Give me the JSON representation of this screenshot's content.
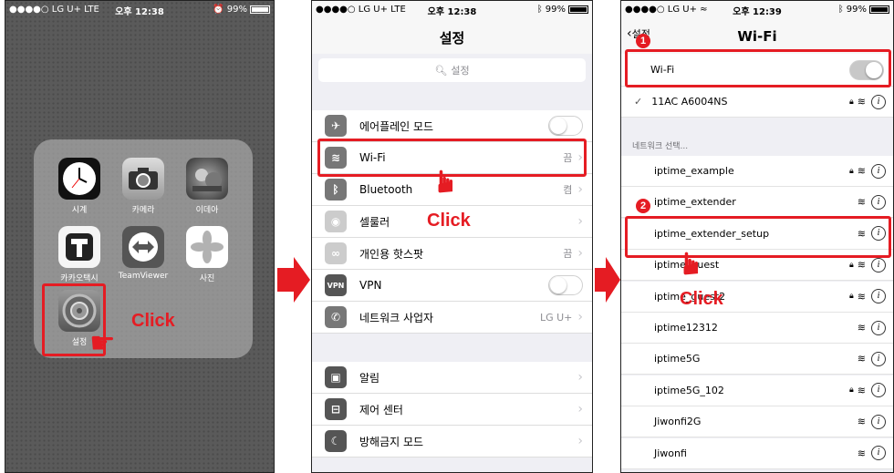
{
  "panel1": {
    "status": {
      "carrier": "●●●●○ LG U+ LTE",
      "time": "오후 12:38",
      "battery": "99%"
    },
    "apps": [
      {
        "name": "clock-app",
        "label": "시계"
      },
      {
        "name": "camera-app",
        "label": "카메라"
      },
      {
        "name": "game-app",
        "label": "이데아"
      },
      {
        "name": "kakaotaxi-app",
        "label": "카카오택시"
      },
      {
        "name": "teamviewer-app",
        "label": "TeamViewer"
      },
      {
        "name": "photos-app",
        "label": "사진"
      },
      {
        "name": "settings-app",
        "label": "설정"
      }
    ],
    "click_label": "Click"
  },
  "panel2": {
    "status": {
      "carrier": "●●●●○ LG U+ LTE",
      "time": "오후 12:38",
      "battery": "99%"
    },
    "title": "설정",
    "search_placeholder": "설정",
    "rows": [
      {
        "label": "에어플레인 모드",
        "value": "",
        "color": "#f29c2b",
        "glyph": "✈"
      },
      {
        "label": "Wi-Fi",
        "value": "끔",
        "color": "#8e8e93",
        "glyph": "≋"
      },
      {
        "label": "Bluetooth",
        "value": "켬",
        "color": "#8e8e93",
        "glyph": "ʙ"
      },
      {
        "label": "셀룰러",
        "value": "",
        "color": "#c7c7cc",
        "glyph": "◉"
      },
      {
        "label": "개인용 핫스팟",
        "value": "끔",
        "color": "#c7c7cc",
        "glyph": "∞"
      },
      {
        "label": "VPN",
        "value": "",
        "color": "#6d6d72",
        "glyph": "VPN"
      },
      {
        "label": "네트워크 사업자",
        "value": "LG U+",
        "color": "#8e8e93",
        "glyph": "✆"
      },
      {
        "label": "알림",
        "value": "",
        "color": "#6d6d72",
        "glyph": "▣"
      },
      {
        "label": "제어 센터",
        "value": "",
        "color": "#6d6d72",
        "glyph": "⊟"
      },
      {
        "label": "방해금지 모드",
        "value": "",
        "color": "#6d6d72",
        "glyph": "☾"
      }
    ],
    "click_label": "Click"
  },
  "panel3": {
    "status": {
      "carrier": "●●●●○ LG U+ ≈",
      "time": "오후 12:39",
      "battery": "99%"
    },
    "back_label": "설정",
    "title": "Wi-Fi",
    "wifi_label": "Wi-Fi",
    "connected": "11AC A6004NS",
    "section": "네트워크 선택...",
    "networks": [
      {
        "name": "iptime_example",
        "locked": true
      },
      {
        "name": "iptime_extender",
        "locked": false
      },
      {
        "name": "iptime_extender_setup",
        "locked": false
      },
      {
        "name": "iptime_guest",
        "locked": true
      },
      {
        "name": "iptime_guest2",
        "locked": true
      },
      {
        "name": "iptime12312",
        "locked": false
      },
      {
        "name": "iptime5G",
        "locked": false
      },
      {
        "name": "iptime5G_102",
        "locked": true
      },
      {
        "name": "Jiwonfi2G",
        "locked": false
      },
      {
        "name": "Jiwonfi",
        "locked": false
      }
    ],
    "badges": [
      "1",
      "2"
    ],
    "click_label": "Click"
  },
  "colors": {
    "highlight": "#e51c23",
    "ios_bg": "#efeff4"
  }
}
